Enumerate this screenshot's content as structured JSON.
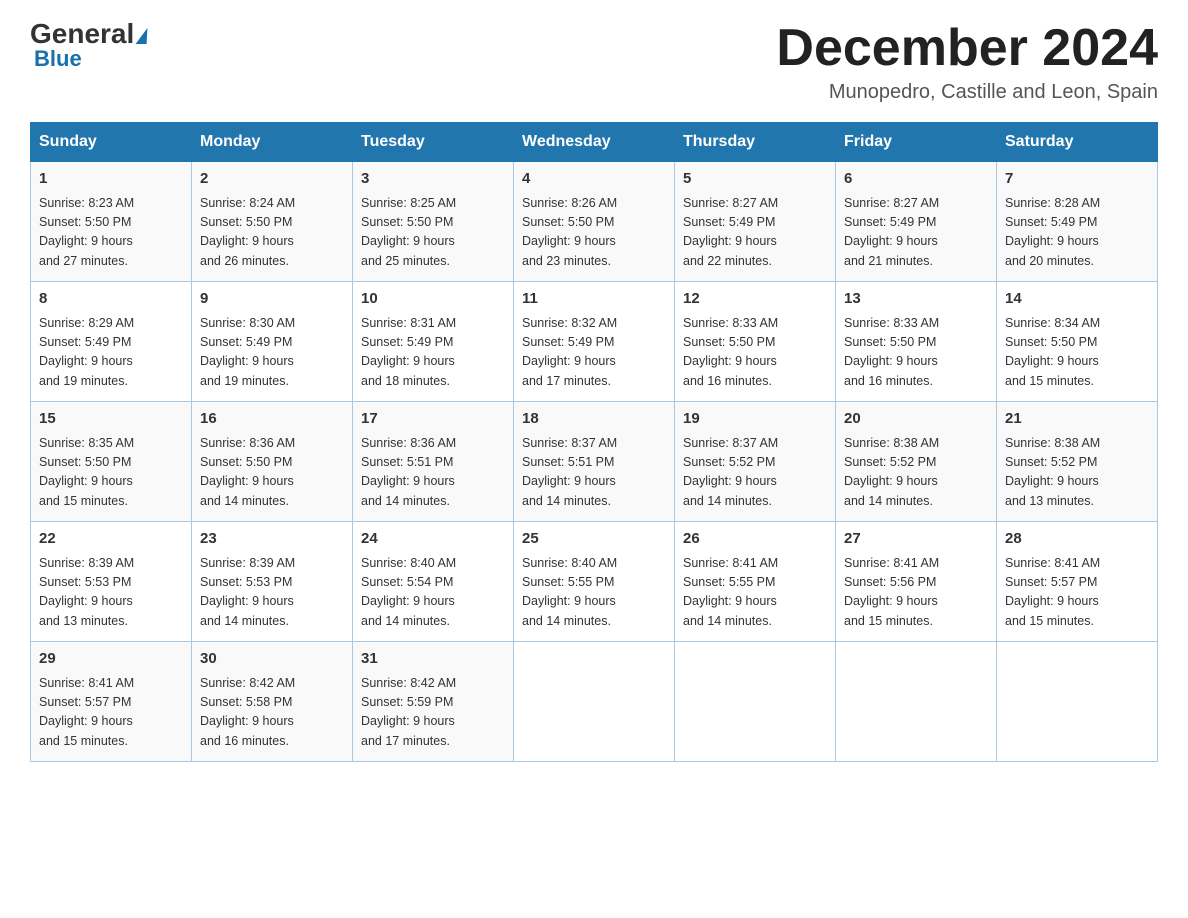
{
  "header": {
    "logo_general": "General",
    "logo_blue": "Blue",
    "month_title": "December 2024",
    "location": "Munopedro, Castille and Leon, Spain"
  },
  "days_of_week": [
    "Sunday",
    "Monday",
    "Tuesday",
    "Wednesday",
    "Thursday",
    "Friday",
    "Saturday"
  ],
  "weeks": [
    [
      {
        "day": "1",
        "sunrise": "8:23 AM",
        "sunset": "5:50 PM",
        "daylight": "9 hours and 27 minutes."
      },
      {
        "day": "2",
        "sunrise": "8:24 AM",
        "sunset": "5:50 PM",
        "daylight": "9 hours and 26 minutes."
      },
      {
        "day": "3",
        "sunrise": "8:25 AM",
        "sunset": "5:50 PM",
        "daylight": "9 hours and 25 minutes."
      },
      {
        "day": "4",
        "sunrise": "8:26 AM",
        "sunset": "5:50 PM",
        "daylight": "9 hours and 23 minutes."
      },
      {
        "day": "5",
        "sunrise": "8:27 AM",
        "sunset": "5:49 PM",
        "daylight": "9 hours and 22 minutes."
      },
      {
        "day": "6",
        "sunrise": "8:27 AM",
        "sunset": "5:49 PM",
        "daylight": "9 hours and 21 minutes."
      },
      {
        "day": "7",
        "sunrise": "8:28 AM",
        "sunset": "5:49 PM",
        "daylight": "9 hours and 20 minutes."
      }
    ],
    [
      {
        "day": "8",
        "sunrise": "8:29 AM",
        "sunset": "5:49 PM",
        "daylight": "9 hours and 19 minutes."
      },
      {
        "day": "9",
        "sunrise": "8:30 AM",
        "sunset": "5:49 PM",
        "daylight": "9 hours and 19 minutes."
      },
      {
        "day": "10",
        "sunrise": "8:31 AM",
        "sunset": "5:49 PM",
        "daylight": "9 hours and 18 minutes."
      },
      {
        "day": "11",
        "sunrise": "8:32 AM",
        "sunset": "5:49 PM",
        "daylight": "9 hours and 17 minutes."
      },
      {
        "day": "12",
        "sunrise": "8:33 AM",
        "sunset": "5:50 PM",
        "daylight": "9 hours and 16 minutes."
      },
      {
        "day": "13",
        "sunrise": "8:33 AM",
        "sunset": "5:50 PM",
        "daylight": "9 hours and 16 minutes."
      },
      {
        "day": "14",
        "sunrise": "8:34 AM",
        "sunset": "5:50 PM",
        "daylight": "9 hours and 15 minutes."
      }
    ],
    [
      {
        "day": "15",
        "sunrise": "8:35 AM",
        "sunset": "5:50 PM",
        "daylight": "9 hours and 15 minutes."
      },
      {
        "day": "16",
        "sunrise": "8:36 AM",
        "sunset": "5:50 PM",
        "daylight": "9 hours and 14 minutes."
      },
      {
        "day": "17",
        "sunrise": "8:36 AM",
        "sunset": "5:51 PM",
        "daylight": "9 hours and 14 minutes."
      },
      {
        "day": "18",
        "sunrise": "8:37 AM",
        "sunset": "5:51 PM",
        "daylight": "9 hours and 14 minutes."
      },
      {
        "day": "19",
        "sunrise": "8:37 AM",
        "sunset": "5:52 PM",
        "daylight": "9 hours and 14 minutes."
      },
      {
        "day": "20",
        "sunrise": "8:38 AM",
        "sunset": "5:52 PM",
        "daylight": "9 hours and 14 minutes."
      },
      {
        "day": "21",
        "sunrise": "8:38 AM",
        "sunset": "5:52 PM",
        "daylight": "9 hours and 13 minutes."
      }
    ],
    [
      {
        "day": "22",
        "sunrise": "8:39 AM",
        "sunset": "5:53 PM",
        "daylight": "9 hours and 13 minutes."
      },
      {
        "day": "23",
        "sunrise": "8:39 AM",
        "sunset": "5:53 PM",
        "daylight": "9 hours and 14 minutes."
      },
      {
        "day": "24",
        "sunrise": "8:40 AM",
        "sunset": "5:54 PM",
        "daylight": "9 hours and 14 minutes."
      },
      {
        "day": "25",
        "sunrise": "8:40 AM",
        "sunset": "5:55 PM",
        "daylight": "9 hours and 14 minutes."
      },
      {
        "day": "26",
        "sunrise": "8:41 AM",
        "sunset": "5:55 PM",
        "daylight": "9 hours and 14 minutes."
      },
      {
        "day": "27",
        "sunrise": "8:41 AM",
        "sunset": "5:56 PM",
        "daylight": "9 hours and 15 minutes."
      },
      {
        "day": "28",
        "sunrise": "8:41 AM",
        "sunset": "5:57 PM",
        "daylight": "9 hours and 15 minutes."
      }
    ],
    [
      {
        "day": "29",
        "sunrise": "8:41 AM",
        "sunset": "5:57 PM",
        "daylight": "9 hours and 15 minutes."
      },
      {
        "day": "30",
        "sunrise": "8:42 AM",
        "sunset": "5:58 PM",
        "daylight": "9 hours and 16 minutes."
      },
      {
        "day": "31",
        "sunrise": "8:42 AM",
        "sunset": "5:59 PM",
        "daylight": "9 hours and 17 minutes."
      },
      null,
      null,
      null,
      null
    ]
  ],
  "labels": {
    "sunrise": "Sunrise:",
    "sunset": "Sunset:",
    "daylight": "Daylight:"
  }
}
